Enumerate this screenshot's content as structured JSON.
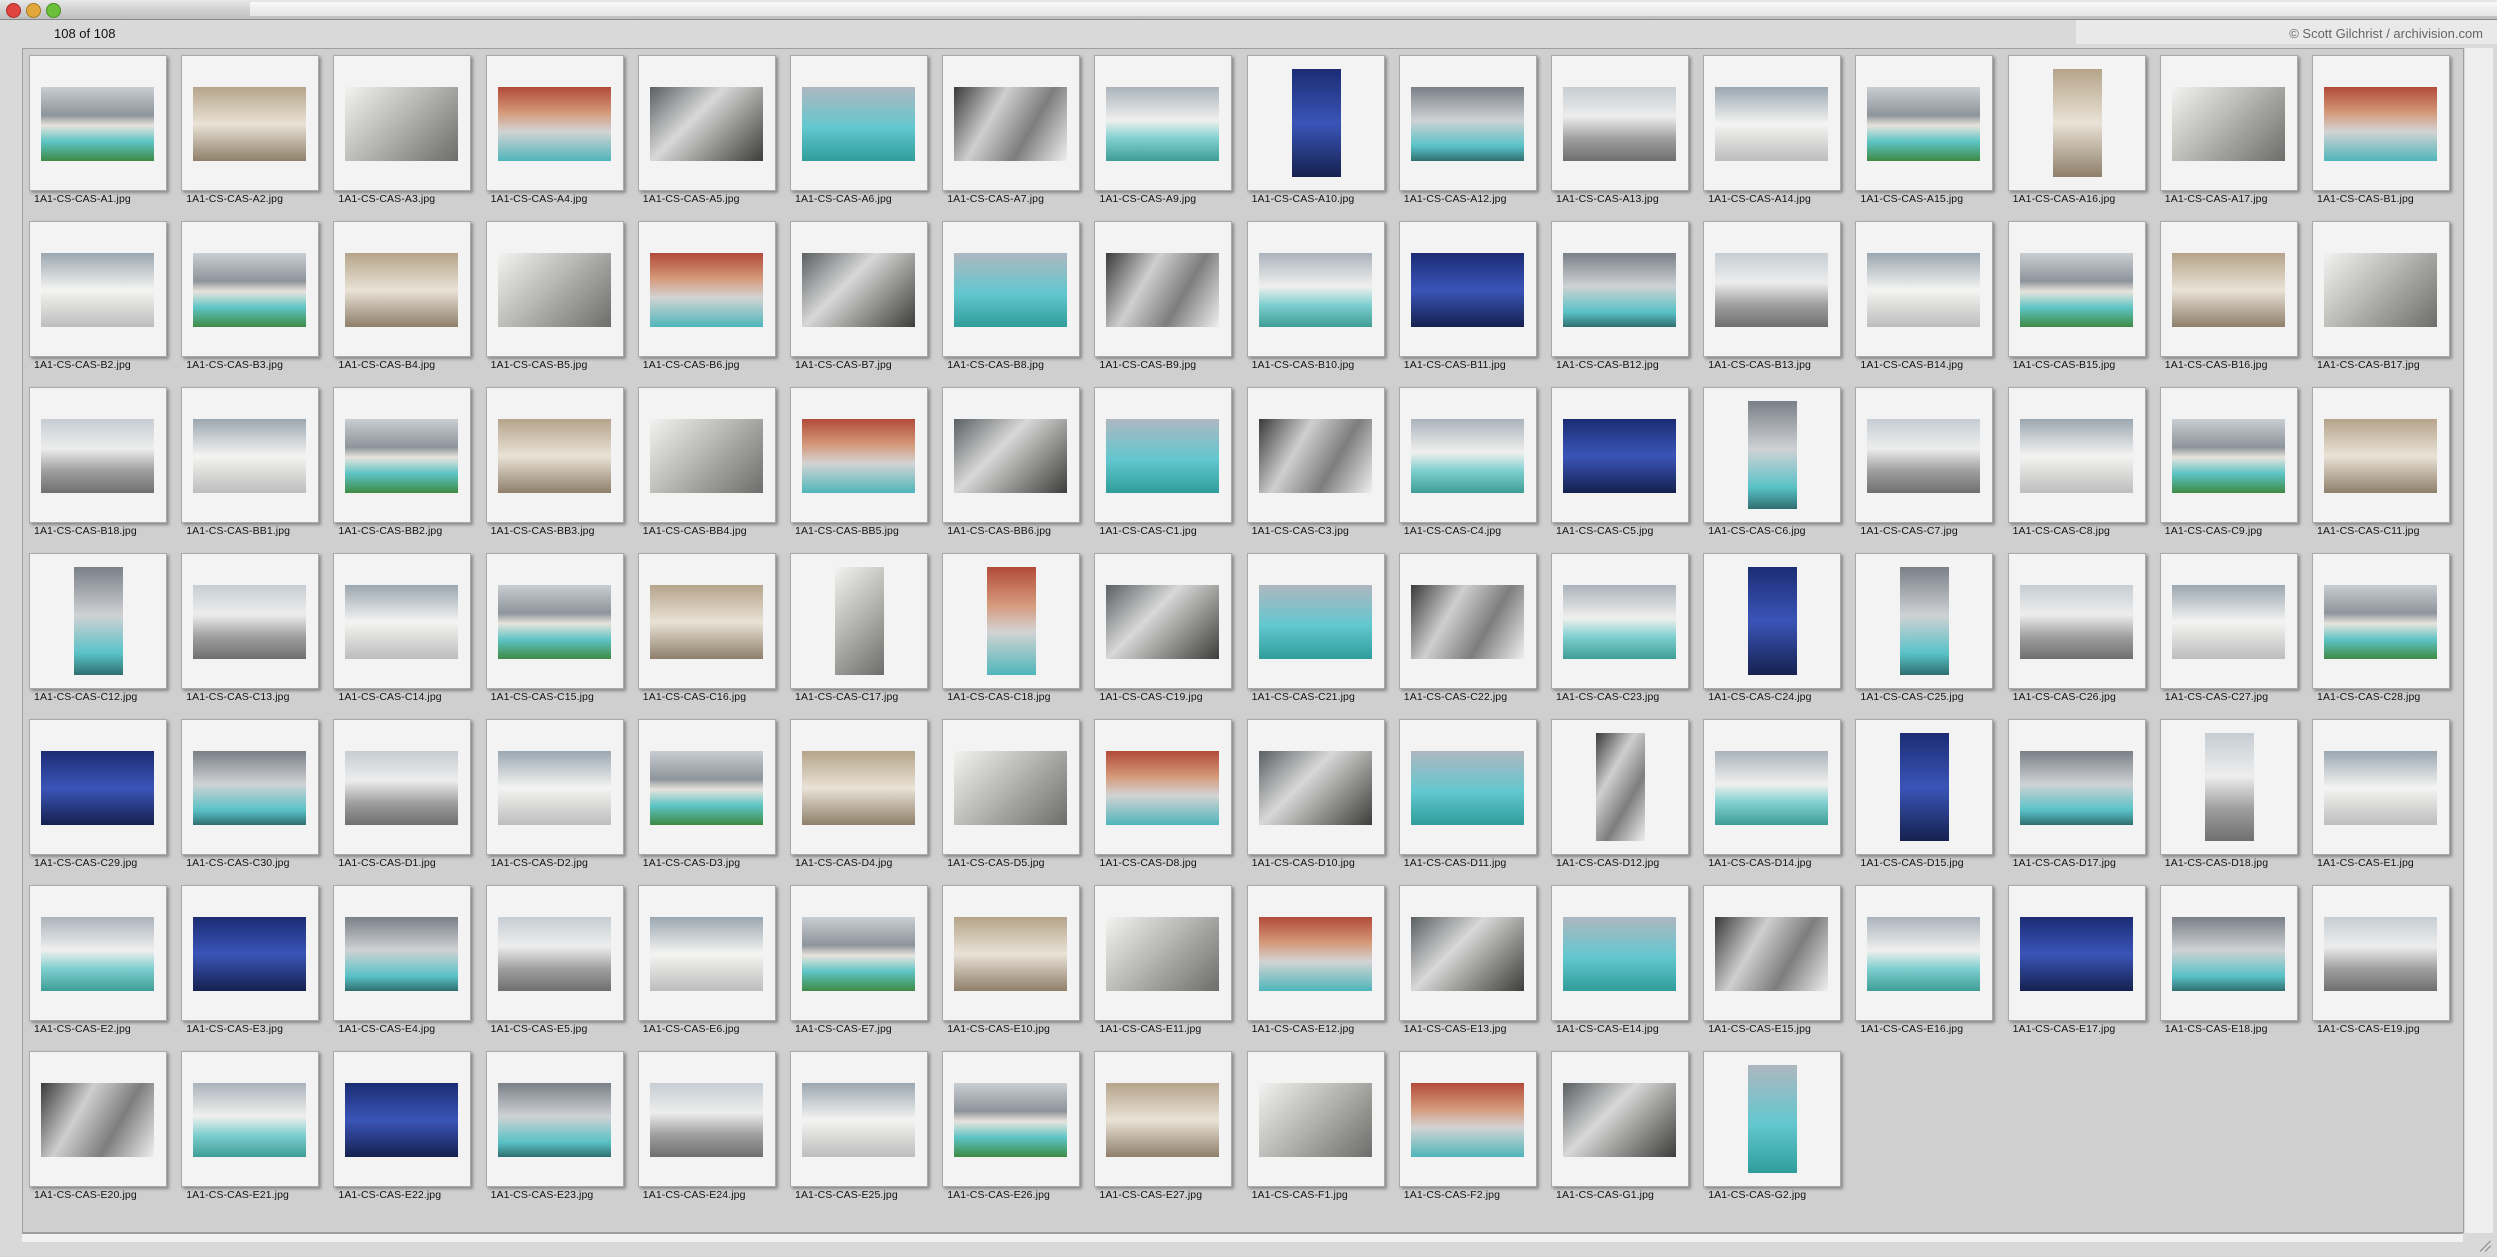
{
  "window": {
    "count_label": "108 of 108",
    "credit": "© Scott Gilchrist / archivision.com"
  },
  "colors": {
    "background": "#d9d9d9",
    "slide": "#f3f3f3",
    "panel": "#cfcfcf"
  },
  "thumbnails": [
    "1A1-CS-CAS-A1.jpg",
    "1A1-CS-CAS-A2.jpg",
    "1A1-CS-CAS-A3.jpg",
    "1A1-CS-CAS-A4.jpg",
    "1A1-CS-CAS-A5.jpg",
    "1A1-CS-CAS-A6.jpg",
    "1A1-CS-CAS-A7.jpg",
    "1A1-CS-CAS-A9.jpg",
    "1A1-CS-CAS-A10.jpg",
    "1A1-CS-CAS-A12.jpg",
    "1A1-CS-CAS-A13.jpg",
    "1A1-CS-CAS-A14.jpg",
    "1A1-CS-CAS-A15.jpg",
    "1A1-CS-CAS-A16.jpg",
    "1A1-CS-CAS-A17.jpg",
    "1A1-CS-CAS-B1.jpg",
    "1A1-CS-CAS-B2.jpg",
    "1A1-CS-CAS-B3.jpg",
    "1A1-CS-CAS-B4.jpg",
    "1A1-CS-CAS-B5.jpg",
    "1A1-CS-CAS-B6.jpg",
    "1A1-CS-CAS-B7.jpg",
    "1A1-CS-CAS-B8.jpg",
    "1A1-CS-CAS-B9.jpg",
    "1A1-CS-CAS-B10.jpg",
    "1A1-CS-CAS-B11.jpg",
    "1A1-CS-CAS-B12.jpg",
    "1A1-CS-CAS-B13.jpg",
    "1A1-CS-CAS-B14.jpg",
    "1A1-CS-CAS-B15.jpg",
    "1A1-CS-CAS-B16.jpg",
    "1A1-CS-CAS-B17.jpg",
    "1A1-CS-CAS-B18.jpg",
    "1A1-CS-CAS-BB1.jpg",
    "1A1-CS-CAS-BB2.jpg",
    "1A1-CS-CAS-BB3.jpg",
    "1A1-CS-CAS-BB4.jpg",
    "1A1-CS-CAS-BB5.jpg",
    "1A1-CS-CAS-BB6.jpg",
    "1A1-CS-CAS-C1.jpg",
    "1A1-CS-CAS-C3.jpg",
    "1A1-CS-CAS-C4.jpg",
    "1A1-CS-CAS-C5.jpg",
    "1A1-CS-CAS-C6.jpg",
    "1A1-CS-CAS-C7.jpg",
    "1A1-CS-CAS-C8.jpg",
    "1A1-CS-CAS-C9.jpg",
    "1A1-CS-CAS-C11.jpg",
    "1A1-CS-CAS-C12.jpg",
    "1A1-CS-CAS-C13.jpg",
    "1A1-CS-CAS-C14.jpg",
    "1A1-CS-CAS-C15.jpg",
    "1A1-CS-CAS-C16.jpg",
    "1A1-CS-CAS-C17.jpg",
    "1A1-CS-CAS-C18.jpg",
    "1A1-CS-CAS-C19.jpg",
    "1A1-CS-CAS-C21.jpg",
    "1A1-CS-CAS-C22.jpg",
    "1A1-CS-CAS-C23.jpg",
    "1A1-CS-CAS-C24.jpg",
    "1A1-CS-CAS-C25.jpg",
    "1A1-CS-CAS-C26.jpg",
    "1A1-CS-CAS-C27.jpg",
    "1A1-CS-CAS-C28.jpg",
    "1A1-CS-CAS-C29.jpg",
    "1A1-CS-CAS-C30.jpg",
    "1A1-CS-CAS-D1.jpg",
    "1A1-CS-CAS-D2.jpg",
    "1A1-CS-CAS-D3.jpg",
    "1A1-CS-CAS-D4.jpg",
    "1A1-CS-CAS-D5.jpg",
    "1A1-CS-CAS-D8.jpg",
    "1A1-CS-CAS-D10.jpg",
    "1A1-CS-CAS-D11.jpg",
    "1A1-CS-CAS-D12.jpg",
    "1A1-CS-CAS-D14.jpg",
    "1A1-CS-CAS-D15.jpg",
    "1A1-CS-CAS-D17.jpg",
    "1A1-CS-CAS-D18.jpg",
    "1A1-CS-CAS-E1.jpg",
    "1A1-CS-CAS-E2.jpg",
    "1A1-CS-CAS-E3.jpg",
    "1A1-CS-CAS-E4.jpg",
    "1A1-CS-CAS-E5.jpg",
    "1A1-CS-CAS-E6.jpg",
    "1A1-CS-CAS-E7.jpg",
    "1A1-CS-CAS-E10.jpg",
    "1A1-CS-CAS-E11.jpg",
    "1A1-CS-CAS-E12.jpg",
    "1A1-CS-CAS-E13.jpg",
    "1A1-CS-CAS-E14.jpg",
    "1A1-CS-CAS-E15.jpg",
    "1A1-CS-CAS-E16.jpg",
    "1A1-CS-CAS-E17.jpg",
    "1A1-CS-CAS-E18.jpg",
    "1A1-CS-CAS-E19.jpg",
    "1A1-CS-CAS-E20.jpg",
    "1A1-CS-CAS-E21.jpg",
    "1A1-CS-CAS-E22.jpg",
    "1A1-CS-CAS-E23.jpg",
    "1A1-CS-CAS-E24.jpg",
    "1A1-CS-CAS-E25.jpg",
    "1A1-CS-CAS-E26.jpg",
    "1A1-CS-CAS-E27.jpg",
    "1A1-CS-CAS-F1.jpg",
    "1A1-CS-CAS-F2.jpg",
    "1A1-CS-CAS-G1.jpg",
    "1A1-CS-CAS-G2.jpg"
  ]
}
